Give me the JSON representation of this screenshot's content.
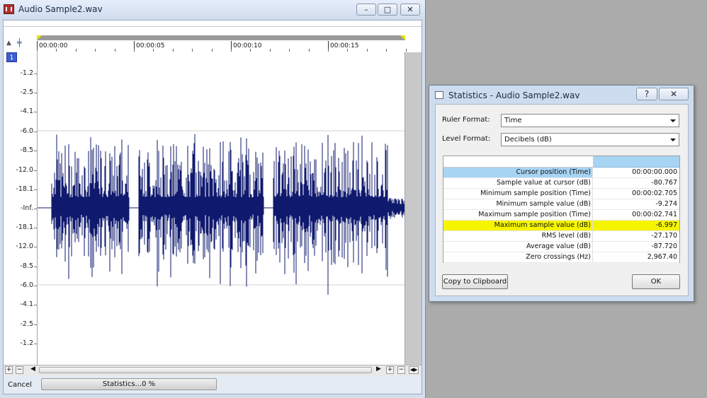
{
  "wave_window": {
    "title": "Audio Sample2.wav",
    "minimize_glyph": "–",
    "maximize_glyph": "□",
    "close_glyph": "✕",
    "lock_glyph": "▲",
    "snap_glyph": "╪",
    "channel_number": "1",
    "ruler_ticks": [
      "00:00:00",
      "00:00:05",
      "00:00:10",
      "00:00:15"
    ],
    "level_labels": [
      "-1.2",
      "-2.5",
      "-4.1",
      "-6.0",
      "-8.5",
      "-12.0",
      "-18.1",
      "-Inf.",
      "-18.1",
      "-12.0",
      "-8.5",
      "-6.0",
      "-4.1",
      "-2.5",
      "-1.2"
    ],
    "scroll": {
      "zoom_in": "+",
      "zoom_out": "−",
      "left_arrow": "◀",
      "right_arrow": "▶",
      "v_zoom_in": "+",
      "v_zoom_out": "−",
      "fit": "◀▶"
    },
    "status": {
      "cancel_label": "Cancel",
      "progress_text": "Statistics...0 %"
    }
  },
  "stats_dialog": {
    "title": "Statistics - Audio Sample2.wav",
    "help_glyph": "?",
    "close_glyph": "✕",
    "ruler_format_label": "Ruler Format:",
    "ruler_format_value": "Time",
    "level_format_label": "Level Format:",
    "level_format_value": "Decibels (dB)",
    "rows": [
      {
        "label": "Cursor position (Time)",
        "value": "00:00:00.000"
      },
      {
        "label": "Sample value at cursor (dB)",
        "value": "-80.767"
      },
      {
        "label": "Minimum sample position (Time)",
        "value": "00:00:02.705"
      },
      {
        "label": "Minimum sample value (dB)",
        "value": "-9.274"
      },
      {
        "label": "Maximum sample position (Time)",
        "value": "00:00:02.741"
      },
      {
        "label": "Maximum sample value (dB)",
        "value": "-6.997"
      },
      {
        "label": "RMS level (dB)",
        "value": "-27.170"
      },
      {
        "label": "Average value (dB)",
        "value": "-87.720"
      },
      {
        "label": "Zero crossings (Hz)",
        "value": "2,967.40"
      }
    ],
    "copy_button": "Copy to Clipboard",
    "ok_button": "OK"
  },
  "colors": {
    "waveform": "#0f1a6e",
    "highlight_yellow": "#f5f500",
    "selection_blue": "#a8d4f4"
  }
}
